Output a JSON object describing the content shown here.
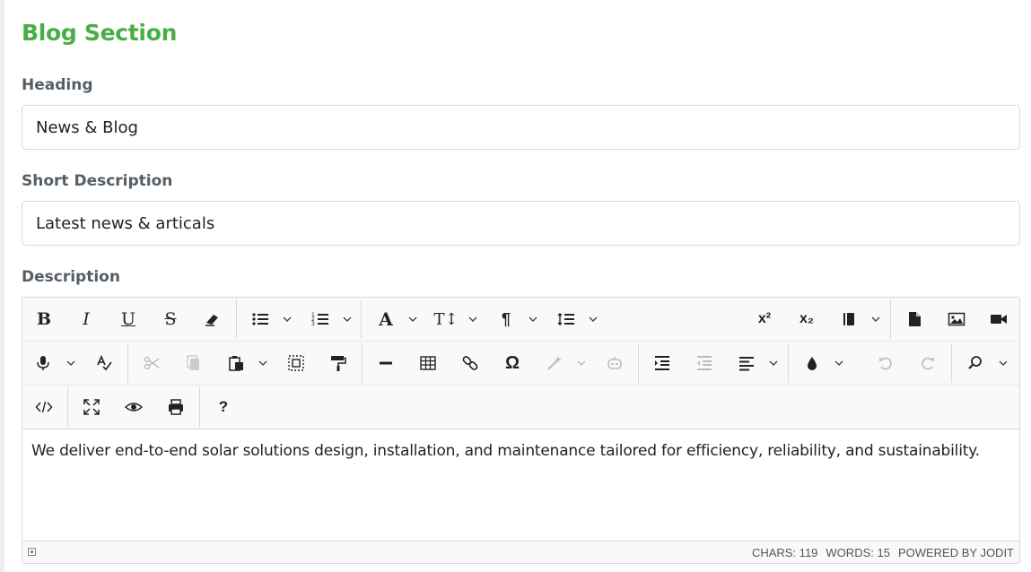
{
  "section": {
    "title": "Blog Section"
  },
  "heading": {
    "label": "Heading",
    "value": "News & Blog"
  },
  "short_description": {
    "label": "Short Description",
    "value": "Latest news & articals"
  },
  "description": {
    "label": "Description",
    "content": "We deliver end-to-end solar solutions design, installation, and maintenance tailored for efficiency, reliability, and sustainability."
  },
  "toolbar": {
    "bold": "B",
    "italic": "I",
    "underline": "U",
    "strikethrough": "S",
    "font": "A",
    "font_size": "T↕",
    "paragraph": "¶",
    "superscript": "x²",
    "subscript": "x₂",
    "symbol": "Ω",
    "help": "?"
  },
  "status_bar": {
    "chars": "CHARS: 119",
    "words": "WORDS: 15",
    "powered": "POWERED BY JODIT"
  },
  "icons": [
    "bold-icon",
    "italic-icon",
    "underline-icon",
    "strikethrough-icon",
    "eraser-icon",
    "bullet-list-icon",
    "numbered-list-icon",
    "font-icon",
    "font-size-icon",
    "paragraph-icon",
    "line-height-icon",
    "superscript-icon",
    "subscript-icon",
    "class-span-icon",
    "file-icon",
    "image-icon",
    "video-icon",
    "microphone-icon",
    "spellcheck-icon",
    "cut-icon",
    "copy-icon",
    "paste-icon",
    "select-all-icon",
    "copy-format-icon",
    "horizontal-rule-icon",
    "table-icon",
    "link-icon",
    "symbol-icon",
    "ai-commands-icon",
    "ai-assistant-icon",
    "indent-icon",
    "outdent-icon",
    "align-icon",
    "brush-icon",
    "undo-icon",
    "redo-icon",
    "search-icon",
    "source-code-icon",
    "fullsize-icon",
    "preview-icon",
    "print-icon",
    "help-icon"
  ],
  "colors": {
    "title": "#4aae48",
    "label": "#555e66",
    "border": "#dadada",
    "toolbar_bg": "#f9f9f9"
  }
}
